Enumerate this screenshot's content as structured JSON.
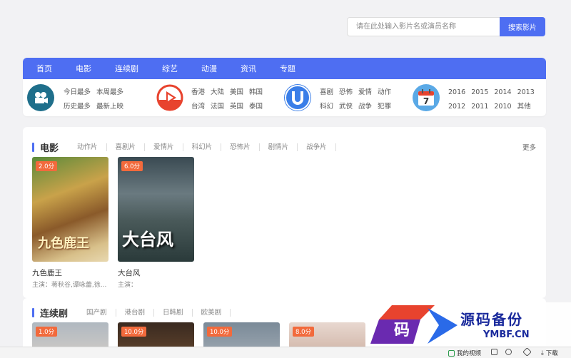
{
  "search": {
    "placeholder": "请在此处输入影片名或演员名称",
    "button": "搜索影片"
  },
  "nav": [
    "首页",
    "电影",
    "连续剧",
    "综艺",
    "动漫",
    "资讯",
    "专题"
  ],
  "categories": {
    "rank": [
      "今日最多",
      "本周最多",
      "历史最多",
      "最新上映"
    ],
    "region": [
      "香港",
      "大陆",
      "美国",
      "韩国",
      "台湾",
      "法国",
      "英国",
      "泰国"
    ],
    "genre": [
      "喜剧",
      "恐怖",
      "爱情",
      "动作",
      "科幻",
      "武侠",
      "战争",
      "犯罪"
    ],
    "year": [
      "2016",
      "2015",
      "2014",
      "2013",
      "2012",
      "2011",
      "2010",
      "其他"
    ],
    "calendar_day": "7"
  },
  "movies": {
    "title": "电影",
    "tags": [
      "动作片",
      "喜剧片",
      "爱情片",
      "科幻片",
      "恐怖片",
      "剧情片",
      "战争片"
    ],
    "more": "更多",
    "items": [
      {
        "score": "2.0分",
        "title": "九色鹿王",
        "actors": "主演：蒋秋谷,谭咏蕾,徐...",
        "poster_text": "九色鹿王"
      },
      {
        "score": "6.0分",
        "title": "大台风",
        "actors": "主演：",
        "poster_text": "大台风"
      }
    ]
  },
  "tv": {
    "title": "连续剧",
    "tags": [
      "国产剧",
      "港台剧",
      "日韩剧",
      "欧美剧"
    ],
    "items": [
      {
        "score": "1.0分"
      },
      {
        "score": "10.0分"
      },
      {
        "score": "10.0分"
      },
      {
        "score": "8.0分"
      }
    ]
  },
  "watermark": {
    "logo_char": "码",
    "name": "源码备份",
    "url": "YMBF.CN"
  },
  "bottombar": {
    "video": "我的视频",
    "download": "下载"
  },
  "colors": {
    "accent": "#4e6ef2",
    "score": "#f26a3c"
  }
}
